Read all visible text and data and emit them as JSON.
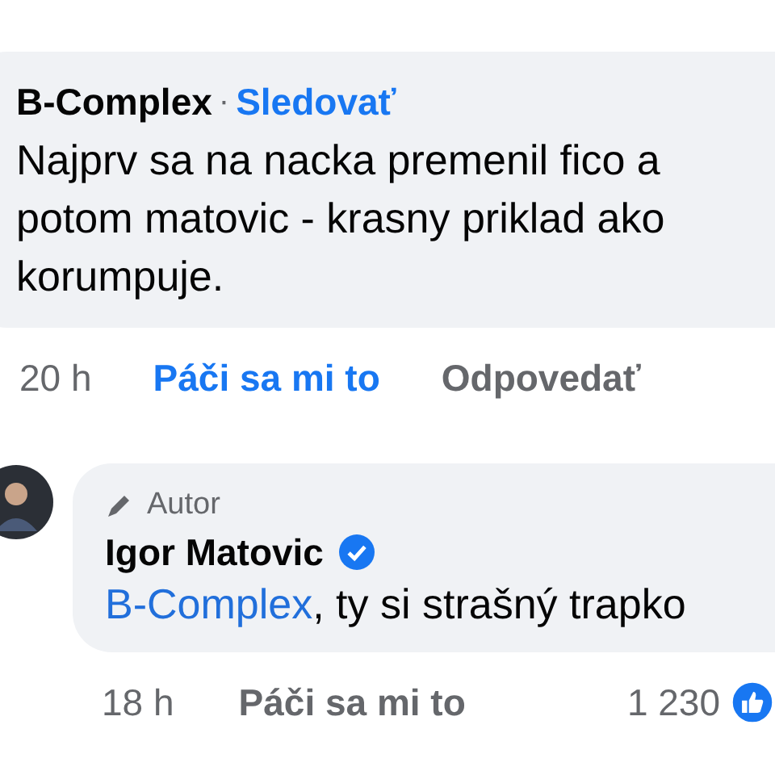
{
  "comments": [
    {
      "author": "B-Complex",
      "separator": "·",
      "follow": "Sledovať",
      "text": "Najprv sa na nacka premenil fico a potom matovic - krasny priklad ako korumpuje.",
      "time": "20 h",
      "like": "Páči sa mi to",
      "liked": true,
      "reply": "Odpovedať"
    },
    {
      "author_badge": "Autor",
      "author": "Igor Matovic",
      "verified": true,
      "avatar": true,
      "mention": "B-Complex",
      "text": ", ty si strašný trapko",
      "time": "18 h",
      "like": "Páči sa mi to",
      "liked": false,
      "reactions": "1 230"
    }
  ]
}
